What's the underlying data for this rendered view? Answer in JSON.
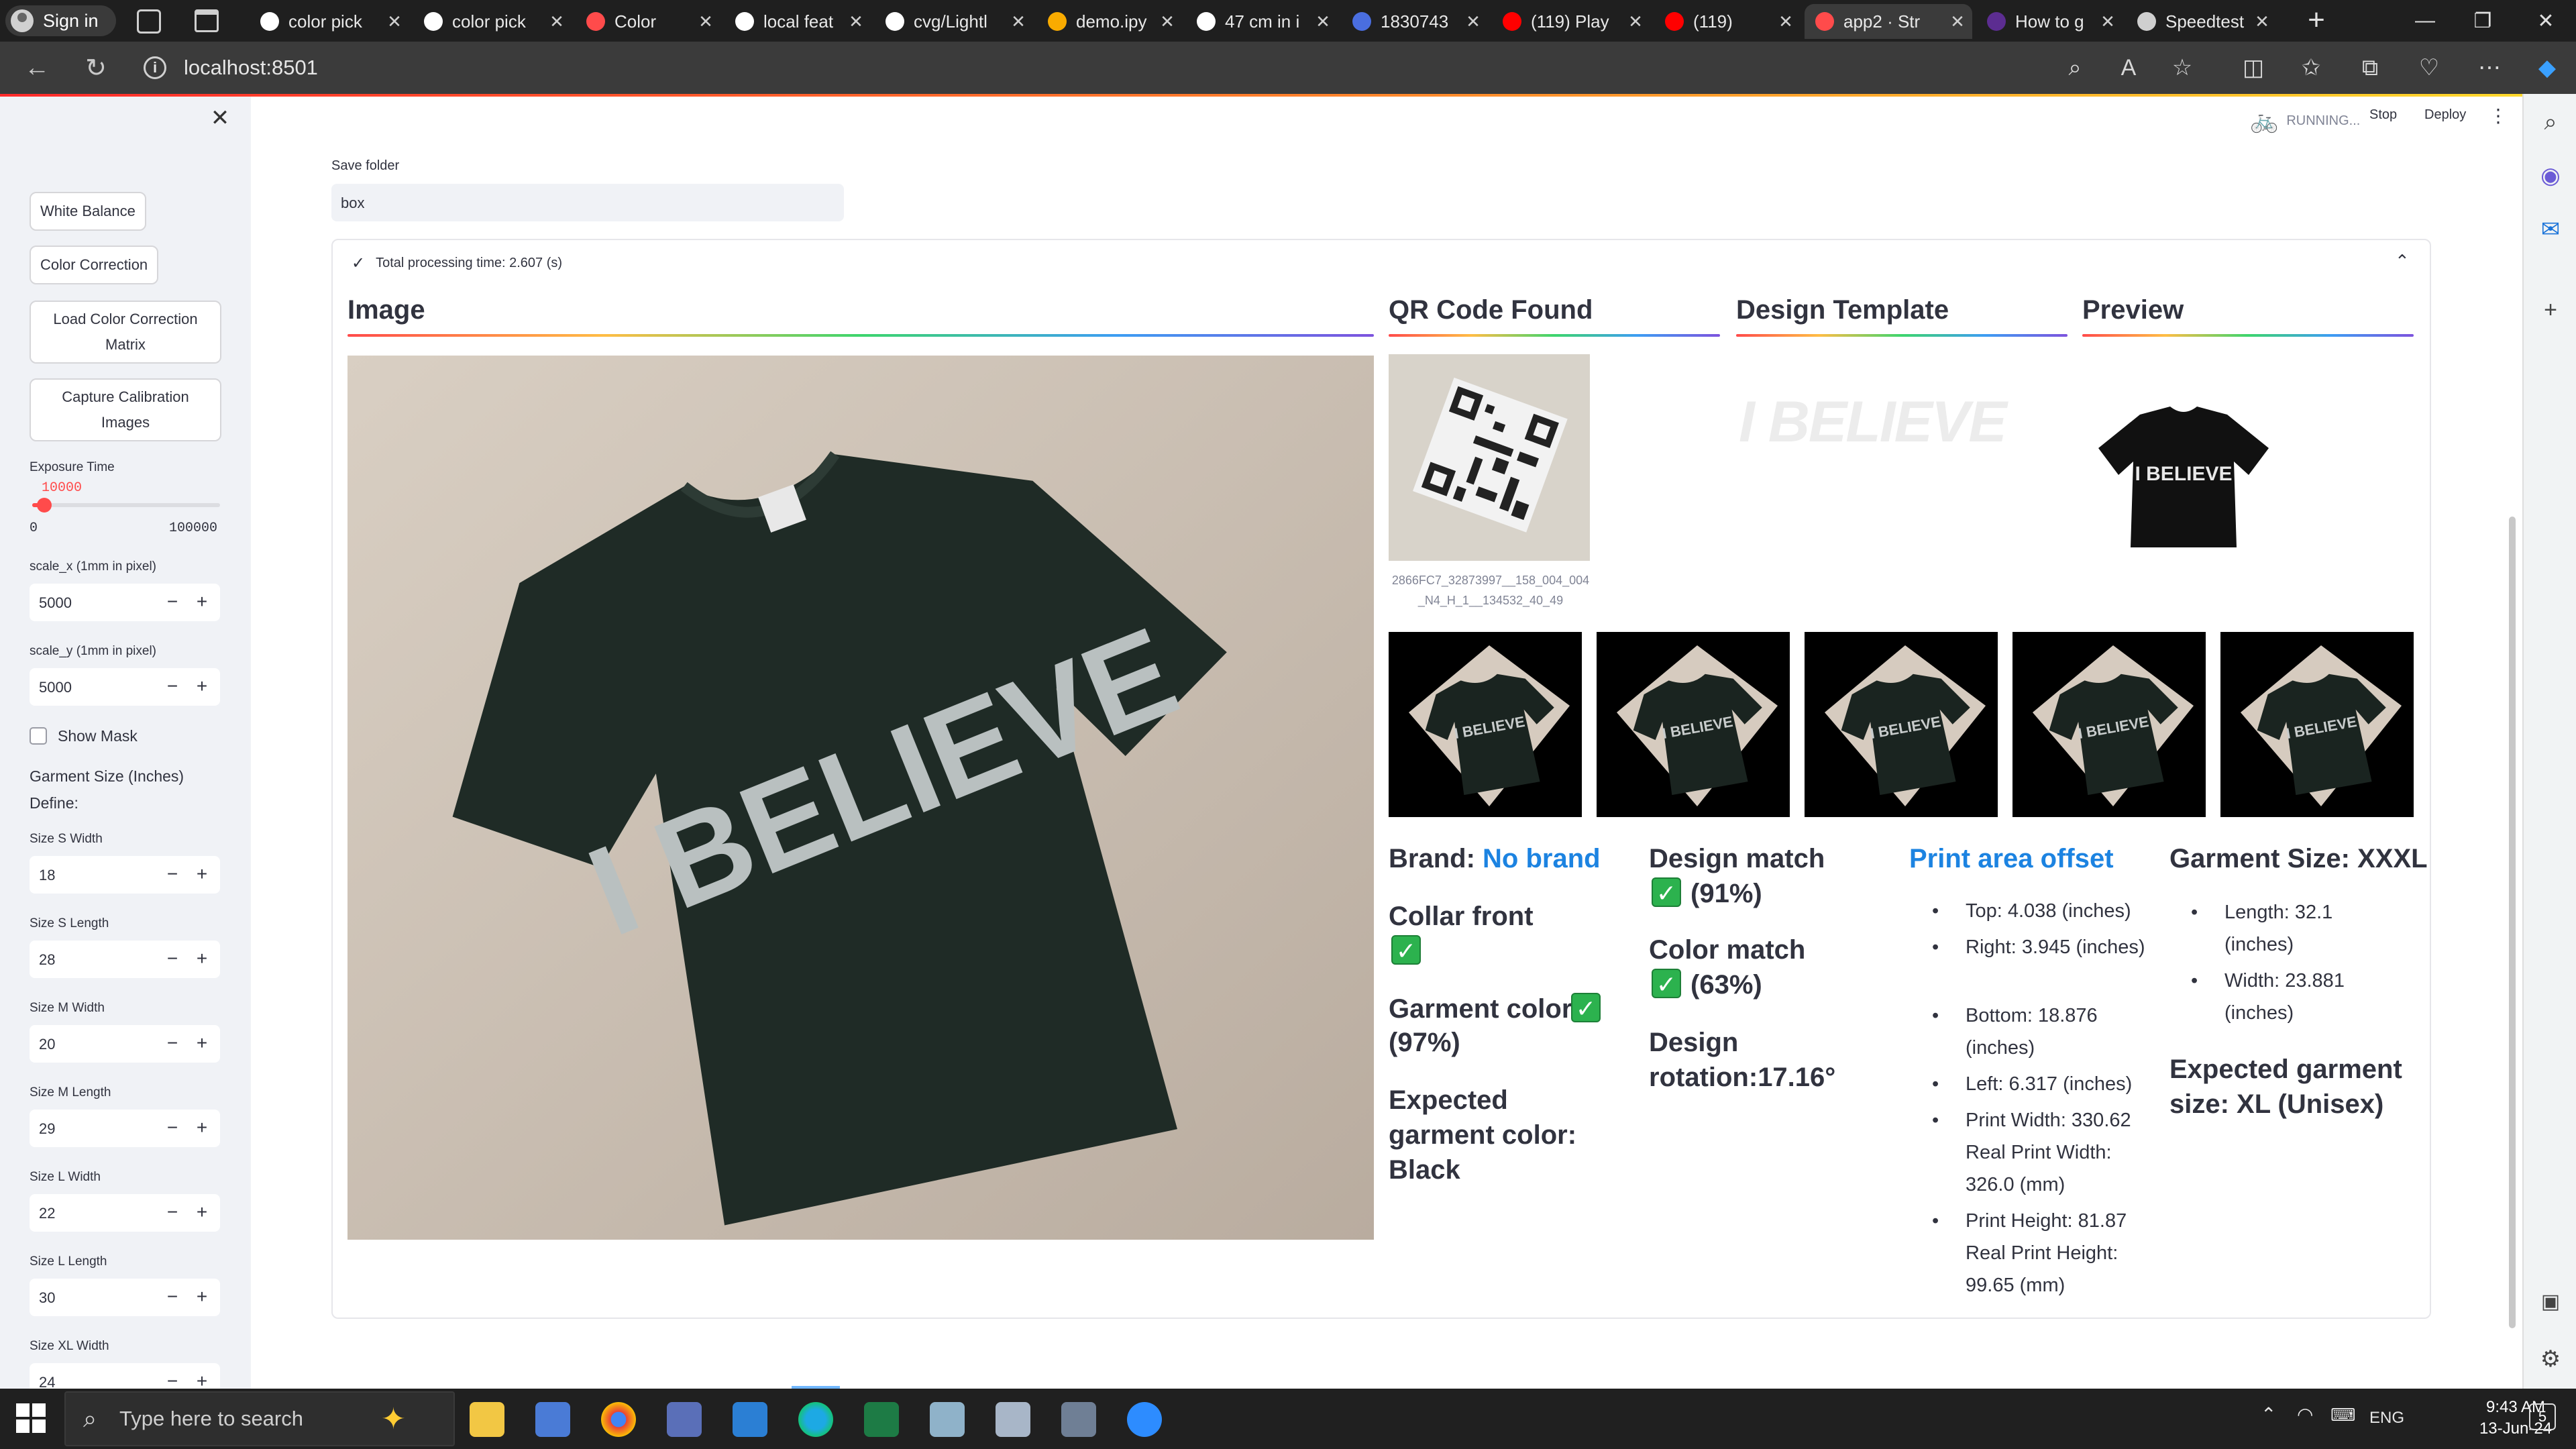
{
  "browser": {
    "profile_label": "Sign in",
    "tabs": [
      {
        "title": "color pick",
        "icon": "google-icon"
      },
      {
        "title": "color pick",
        "icon": "google-icon"
      },
      {
        "title": "Color",
        "icon": "streamlit-icon"
      },
      {
        "title": "local feat",
        "icon": "google-icon"
      },
      {
        "title": "cvg/Lightl",
        "icon": "github-icon"
      },
      {
        "title": "demo.ipy",
        "icon": "colab-icon"
      },
      {
        "title": "47 cm in i",
        "icon": "google-icon"
      },
      {
        "title": "1830743",
        "icon": "scholar-icon"
      },
      {
        "title": "(119) Play",
        "icon": "youtube-icon"
      },
      {
        "title": "(119)",
        "icon": "youtube-icon"
      },
      {
        "title": "app2 · Str",
        "icon": "streamlit-icon"
      },
      {
        "title": "How to g",
        "icon": "vs-icon"
      },
      {
        "title": "Speedtest",
        "icon": "speedtest-icon"
      }
    ],
    "active_tab": 10,
    "url": "localhost:8501"
  },
  "sidebar": {
    "buttons": [
      "White Balance",
      "Color Correction",
      "Load Color Correction Matrix",
      "Capture Calibration Images"
    ],
    "exposure": {
      "label": "Exposure Time",
      "value": "10000",
      "min": "0",
      "max": "100000",
      "fraction": 0.1
    },
    "scale_x": {
      "label": "scale_x (1mm in pixel)",
      "value": "5000"
    },
    "scale_y": {
      "label": "scale_y (1mm in pixel)",
      "value": "5000"
    },
    "show_mask": "Show Mask",
    "garment_size_title": "Garment Size (Inches)",
    "define_label": "Define:",
    "sizes": [
      {
        "label": "Size S Width",
        "value": "18"
      },
      {
        "label": "Size S Length",
        "value": "28"
      },
      {
        "label": "Size M Width",
        "value": "20"
      },
      {
        "label": "Size M Length",
        "value": "29"
      },
      {
        "label": "Size L Width",
        "value": "22"
      },
      {
        "label": "Size L Length",
        "value": "30"
      },
      {
        "label": "Size XL Width",
        "value": "24"
      }
    ]
  },
  "header": {
    "status": "RUNNING...",
    "stop": "Stop",
    "deploy": "Deploy"
  },
  "save_folder": {
    "label": "Save folder",
    "value": "box"
  },
  "expander": {
    "title": "Total processing time: 2.607 (s)"
  },
  "columns": {
    "image": "Image",
    "qr": "QR Code Found",
    "template": "Design Template",
    "preview": "Preview"
  },
  "qr_caption": "2866FC7_32873997__158_004_004_N4_H_1__134532_40_49",
  "shirt_text": "I BELIEVE",
  "results": {
    "brand_label": "Brand:",
    "brand_value": "No brand",
    "collar": "Collar front",
    "garment_color": "Garment color:",
    "garment_color_pct": "(97%)",
    "expected_color": "Expected garment color: Black",
    "design_match": "Design match",
    "design_match_pct": "(91%)",
    "color_match": "Color match",
    "color_match_pct": "(63%)",
    "design_rotation": "Design rotation:17.16°",
    "print_area_title": "Print area offset",
    "print_area": [
      "Top: 4.038 (inches)",
      "Right: 3.945 (inches)",
      "Bottom: 18.876 (inches)",
      "Left: 6.317 (inches)",
      "Print Width: 330.62 Real Print Width: 326.0 (mm)",
      "Print Height: 81.87 Real Print Height: 99.65 (mm)"
    ],
    "garment_size_title": "Garment Size: XXXL",
    "garment_size": [
      "Length: 32.1 (inches)",
      "Width: 23.881 (inches)"
    ],
    "expected_size": "Expected garment size: XL (Unisex)"
  },
  "taskbar": {
    "search_placeholder": "Type here to search",
    "lang": "ENG",
    "time": "9:43 AM",
    "date": "13-Jun-24",
    "notif_count": "5"
  },
  "colors": {
    "accent_red": "#ff4b4b",
    "link_blue": "#1c83e1",
    "check_green": "#2cb24e"
  }
}
